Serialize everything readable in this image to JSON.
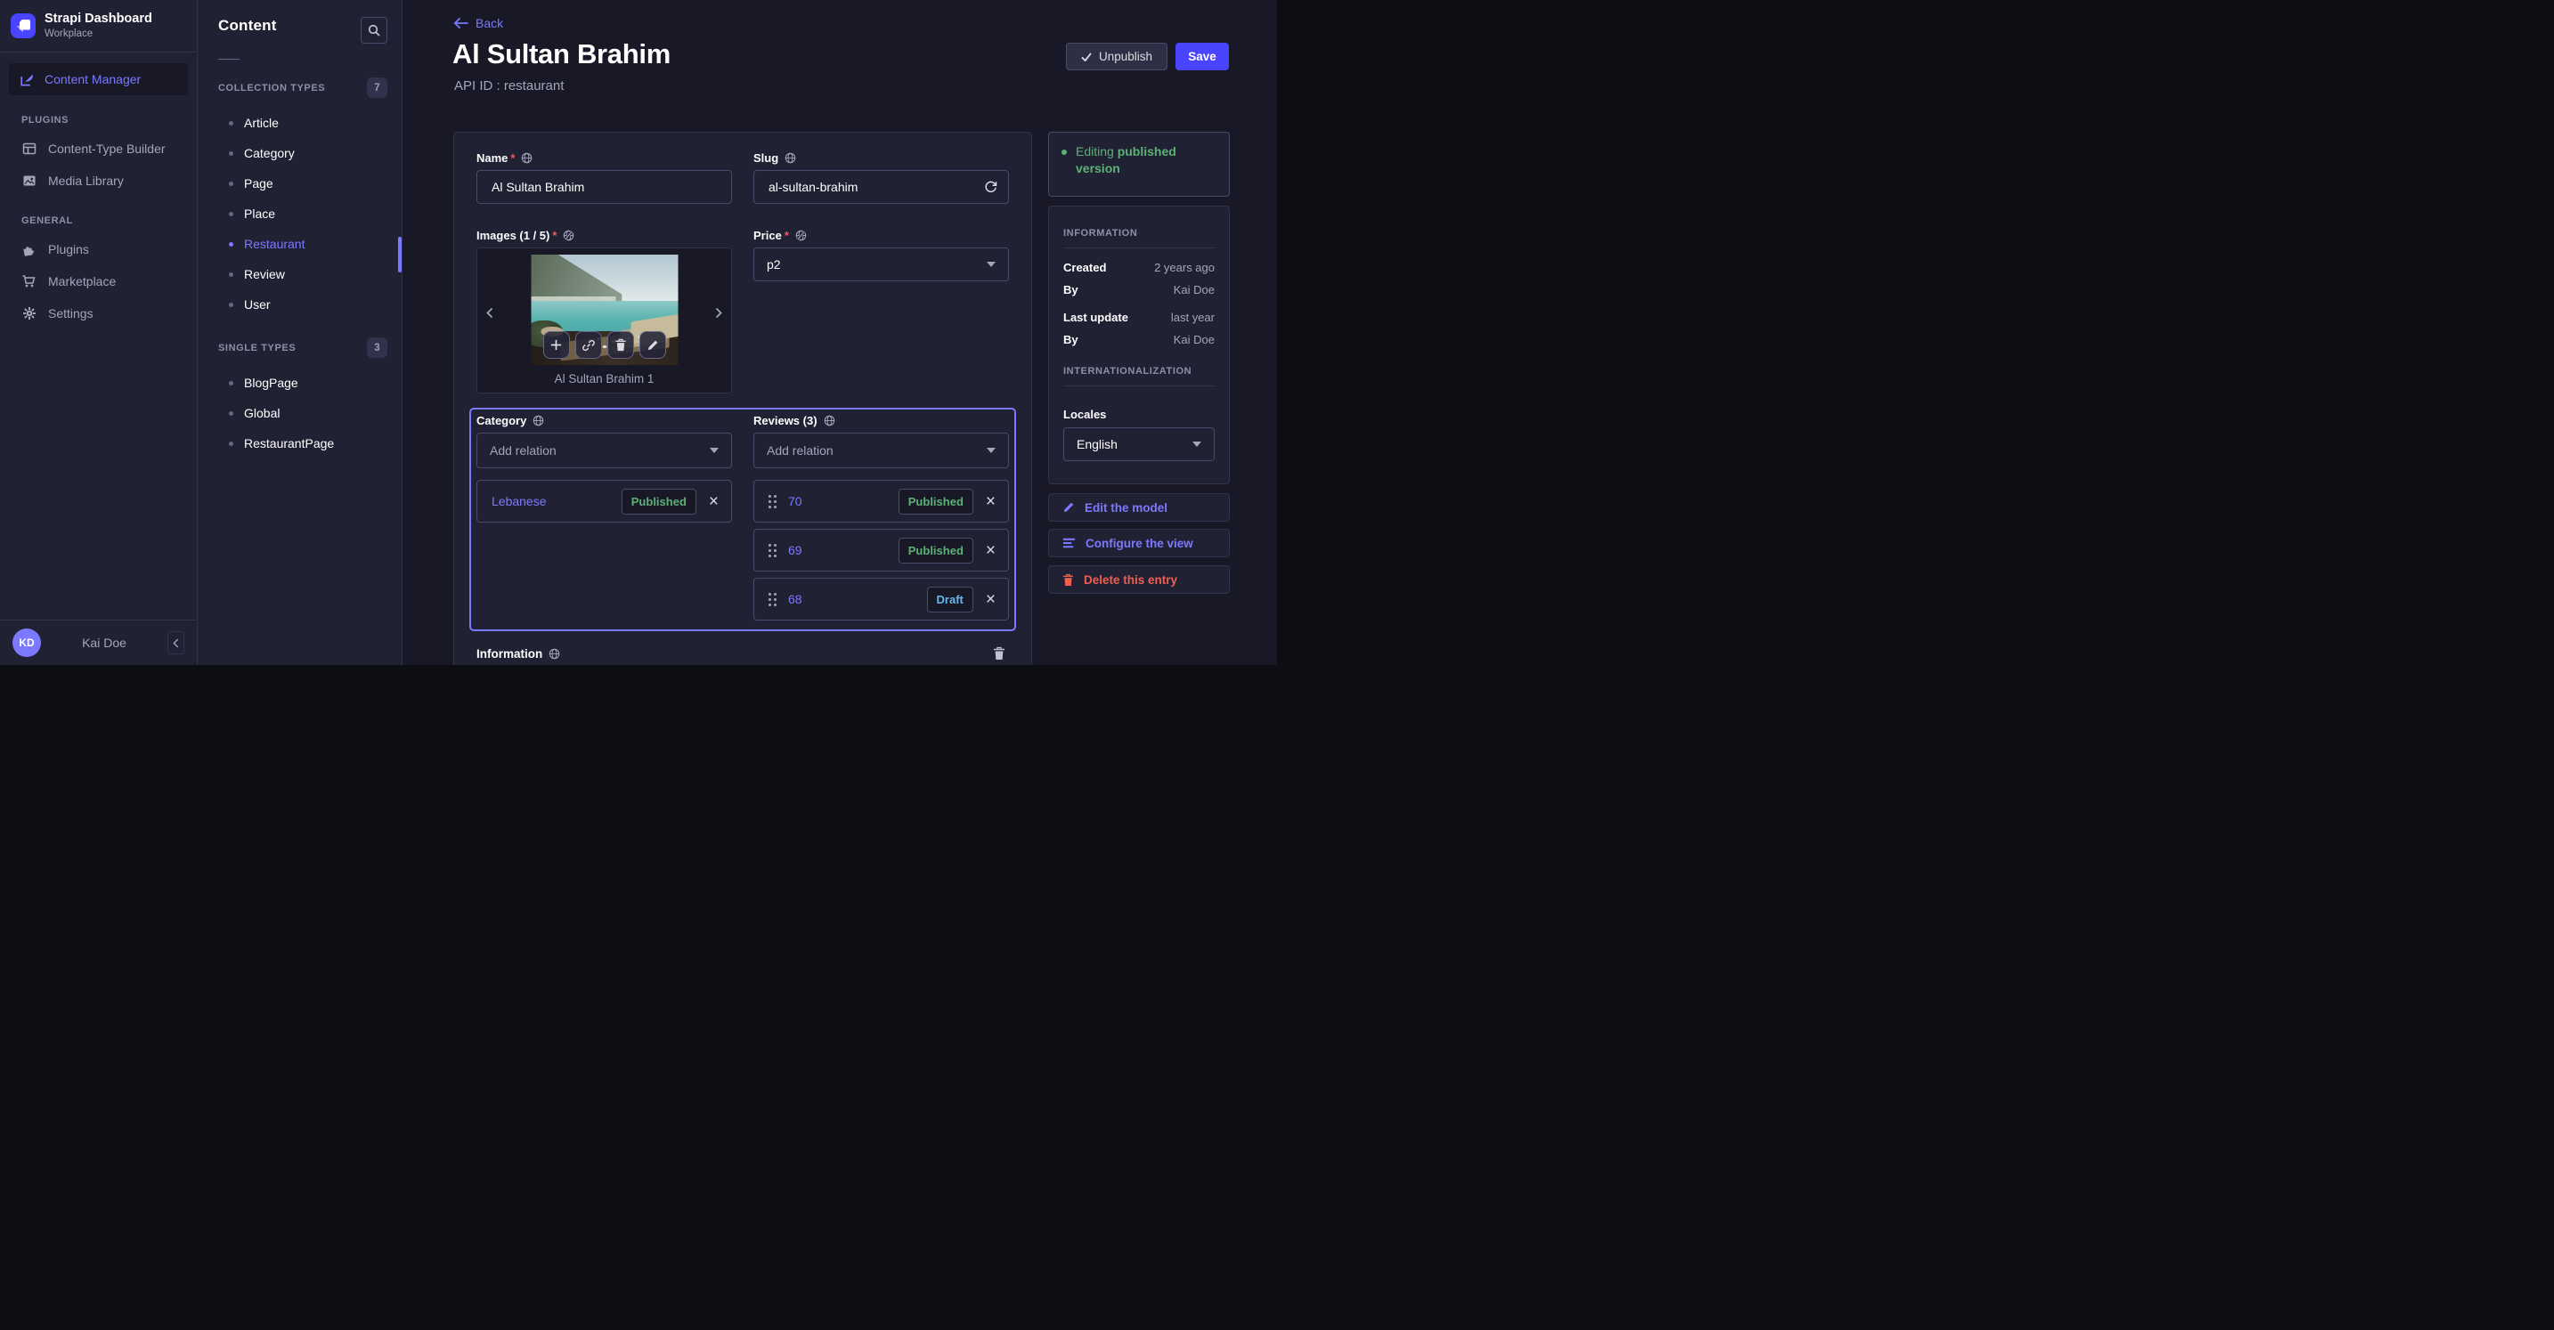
{
  "app": {
    "title": "Strapi Dashboard",
    "subtitle": "Workplace"
  },
  "nav": {
    "active_item": "Content Manager",
    "sections": [
      {
        "title": "PLUGINS",
        "items": [
          "Content-Type Builder",
          "Media Library"
        ]
      },
      {
        "title": "GENERAL",
        "items": [
          "Plugins",
          "Marketplace",
          "Settings"
        ]
      }
    ]
  },
  "footer": {
    "initials": "KD",
    "name": "Kai Doe"
  },
  "content_panel": {
    "title": "Content",
    "groups": [
      {
        "title": "COLLECTION TYPES",
        "count": "7",
        "items": [
          "Article",
          "Category",
          "Page",
          "Place",
          "Restaurant",
          "Review",
          "User"
        ],
        "active": "Restaurant"
      },
      {
        "title": "SINGLE TYPES",
        "count": "3",
        "items": [
          "BlogPage",
          "Global",
          "RestaurantPage"
        ]
      }
    ]
  },
  "header": {
    "back": "Back",
    "title": "Al Sultan Brahim",
    "subtitle": "API ID : restaurant",
    "unpublish": "Unpublish",
    "save": "Save"
  },
  "form": {
    "name": {
      "label": "Name",
      "star": "*",
      "value": "Al Sultan Brahim"
    },
    "slug": {
      "label": "Slug",
      "value": "al-sultan-brahim"
    },
    "images": {
      "label": "Images (1 / 5)",
      "star": "*",
      "caption": "Al Sultan Brahim 1"
    },
    "price": {
      "label": "Price",
      "star": "*",
      "value": "p2"
    },
    "category": {
      "label": "Category",
      "placeholder": "Add relation",
      "relation": {
        "name": "Lebanese",
        "status": "Published"
      }
    },
    "reviews": {
      "label": "Reviews (3)",
      "placeholder": "Add relation",
      "items": [
        {
          "name": "70",
          "status": "Published"
        },
        {
          "name": "69",
          "status": "Published"
        },
        {
          "name": "68",
          "status": "Draft"
        }
      ]
    },
    "component_label": "Information"
  },
  "panel": {
    "status_prefix": "Editing ",
    "status_bold": "published version",
    "info_title": "INFORMATION",
    "info_rows": [
      {
        "label": "Created",
        "value": "2 years ago"
      },
      {
        "label": "By",
        "value": "Kai Doe"
      },
      {
        "label": "Last update",
        "value": "last year"
      },
      {
        "label": "By",
        "value": "Kai Doe"
      }
    ],
    "i18n_title": "INTERNATIONALIZATION",
    "locales_label": "Locales",
    "locale": "English",
    "actions": {
      "edit": "Edit the model",
      "configure": "Configure the view",
      "delete": "Delete this entry"
    }
  },
  "glyphs": {
    "close": "×"
  },
  "colors": {
    "primary": "#4945ff",
    "accent": "#7b79ff",
    "success": "#5cb176",
    "draft": "#66b7f1",
    "danger": "#ee5e52",
    "background": "#181826",
    "surface": "#212134"
  }
}
